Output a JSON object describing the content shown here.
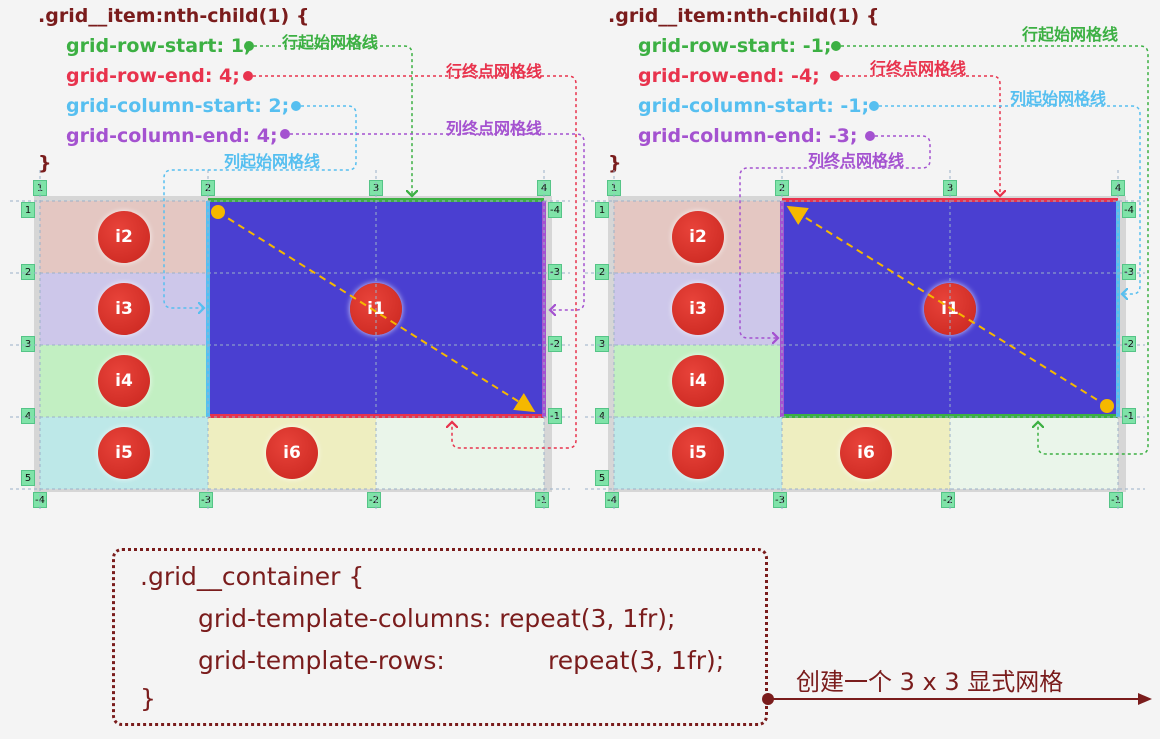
{
  "left": {
    "selector": ".grid__item:nth-child(1) {",
    "row_start": "grid-row-start: 1;",
    "row_end": "grid-row-end: 4;",
    "col_start": "grid-column-start: 2;",
    "col_end": "grid-column-end: 4;",
    "close": "}",
    "label_row_start": "行起始网格线",
    "label_row_end": "行终点网格线",
    "label_col_start": "列起始网格线",
    "label_col_end": "列终点网格线",
    "col_top_tags": [
      "1",
      "2",
      "3",
      "4"
    ],
    "col_bottom_tags": [
      "-4",
      "-3",
      "-2",
      "-1"
    ],
    "row_left_tags": [
      "1",
      "2",
      "3",
      "4",
      "5"
    ],
    "row_right_tags": [
      "-4",
      "-3",
      "-2",
      "-1"
    ],
    "items": [
      "i2",
      "i3",
      "i4",
      "i5",
      "i1",
      "i6"
    ]
  },
  "right": {
    "selector": ".grid__item:nth-child(1) {",
    "row_start": "grid-row-start: -1;",
    "row_end": "grid-row-end: -4;",
    "col_start": "grid-column-start: -1;",
    "col_end": "grid-column-end: -3;",
    "close": "}",
    "label_row_start": "行起始网格线",
    "label_row_end": "行终点网格线",
    "label_col_start": "列起始网格线",
    "label_col_end": "列终点网格线",
    "col_top_tags": [
      "1",
      "2",
      "3",
      "4"
    ],
    "col_bottom_tags": [
      "-4",
      "-3",
      "-2",
      "-1"
    ],
    "row_left_tags": [
      "1",
      "2",
      "3",
      "4",
      "5"
    ],
    "row_right_tags": [
      "-4",
      "-3",
      "-2",
      "-1"
    ],
    "items": [
      "i2",
      "i3",
      "i4",
      "i5",
      "i1",
      "i6"
    ]
  },
  "container": {
    "line1": ".grid__container {",
    "line2": "grid-template-columns: repeat(3, 1fr);",
    "line3a": "grid-template-rows:",
    "line3b": "repeat(3, 1fr);",
    "line4": "}",
    "caption": "创建一个 3 x 3 显式网格"
  },
  "colors": {
    "item1": "#4a3fd1",
    "row_start": "#3cb043",
    "row_end": "#e8334d",
    "col_start": "#56bff0",
    "col_end": "#a452d0",
    "diagonal": "#f5b800",
    "dark_red": "#7a1c1c"
  }
}
